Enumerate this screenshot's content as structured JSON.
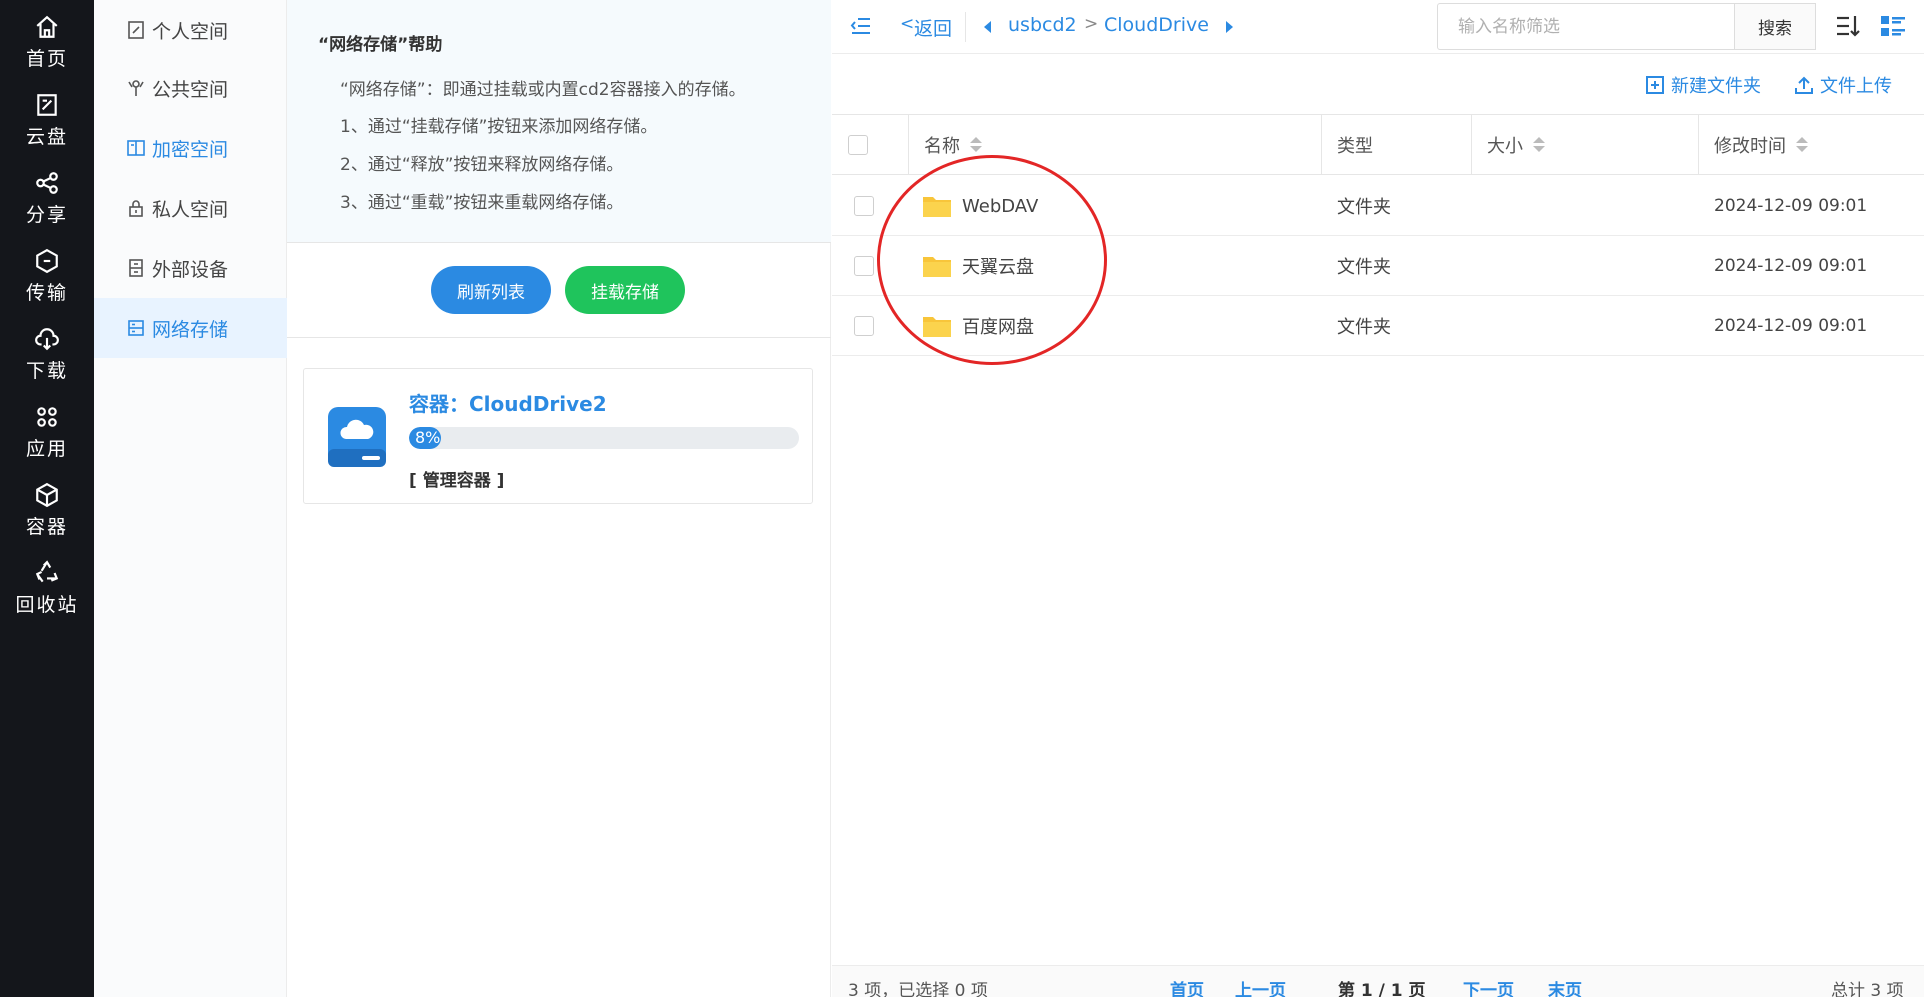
{
  "nav": {
    "items": [
      {
        "label": "首页",
        "icon": "home-icon"
      },
      {
        "label": "云盘",
        "icon": "cloud-disk-icon"
      },
      {
        "label": "分享",
        "icon": "share-icon"
      },
      {
        "label": "传输",
        "icon": "transfer-icon"
      },
      {
        "label": "下载",
        "icon": "download-icon"
      },
      {
        "label": "应用",
        "icon": "apps-icon"
      },
      {
        "label": "容器",
        "icon": "container-icon"
      },
      {
        "label": "回收站",
        "icon": "recycle-icon"
      }
    ]
  },
  "subnav": {
    "items": [
      {
        "label": "个人空间",
        "icon": "personal-space-icon"
      },
      {
        "label": "公共空间",
        "icon": "public-space-icon"
      },
      {
        "label": "加密空间",
        "icon": "encrypted-space-icon"
      },
      {
        "label": "私人空间",
        "icon": "lock-icon"
      },
      {
        "label": "外部设备",
        "icon": "external-device-icon"
      },
      {
        "label": "网络存储",
        "icon": "network-storage-icon"
      }
    ],
    "active_index": 5,
    "accent_color": "#2b8ae2"
  },
  "help": {
    "title": "“网络存储”帮助",
    "lines": [
      "“网络存储”：即通过挂载或内置cd2容器接入的存储。",
      "1、通过“挂载存储”按钮来添加网络存储。",
      "2、通过“释放”按钮来释放网络存储。",
      "3、通过“重载”按钮来重载网络存储。"
    ],
    "refresh_label": "刷新列表",
    "mount_label": "挂载存储"
  },
  "container": {
    "title": "容器：CloudDrive2",
    "progress_percent": 8,
    "progress_text": "8%",
    "manage_label": "[ 管理容器 ]"
  },
  "topbar": {
    "back_label": "返回",
    "breadcrumb": [
      "usbcd2",
      "CloudDrive"
    ],
    "search_placeholder": "输入名称筛选",
    "search_label": "搜索"
  },
  "toolbar": {
    "new_folder_label": "新建文件夹",
    "upload_label": "文件上传"
  },
  "table": {
    "headers": {
      "name": "名称",
      "type": "类型",
      "size": "大小",
      "modified": "修改时间"
    },
    "rows": [
      {
        "name": "WebDAV",
        "type": "文件夹",
        "size": "",
        "modified": "2024-12-09 09:01"
      },
      {
        "name": "天翼云盘",
        "type": "文件夹",
        "size": "",
        "modified": "2024-12-09 09:01"
      },
      {
        "name": "百度网盘",
        "type": "文件夹",
        "size": "",
        "modified": "2024-12-09 09:01"
      }
    ]
  },
  "footer": {
    "summary": "3 项，已选择 0 项",
    "first": "首页",
    "prev": "上一页",
    "page": "第 1 / 1 页",
    "next": "下一页",
    "last": "末页",
    "total": "总计 3 项"
  },
  "colors": {
    "primary": "#2b8ae2",
    "green": "#1fc45c",
    "folder": "#f8c53a",
    "annotation": "#e32626",
    "nav_bg": "#14161b"
  }
}
